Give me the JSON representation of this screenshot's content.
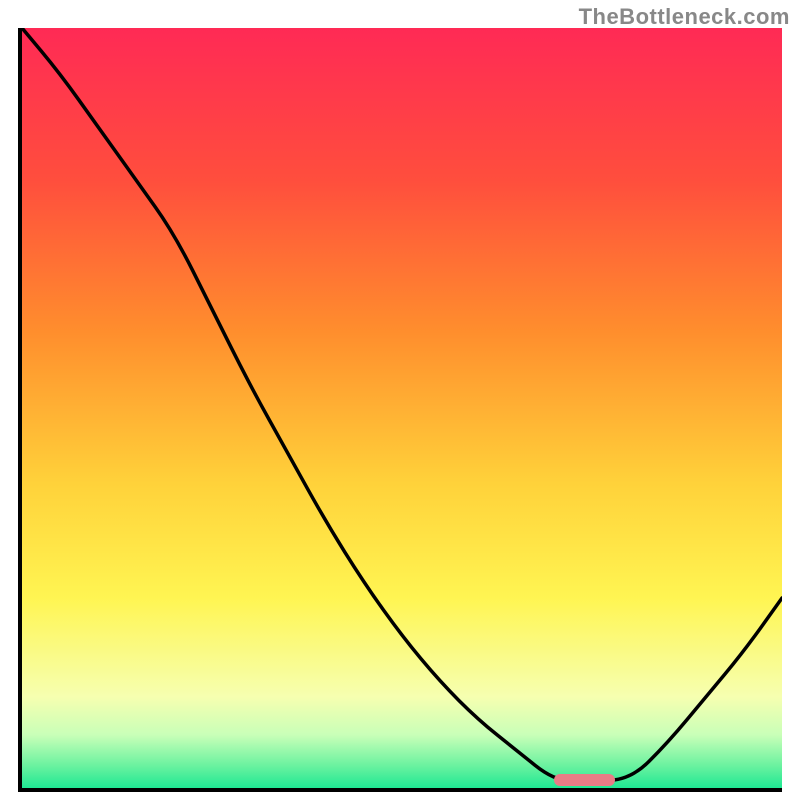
{
  "attribution": "TheBottleneck.com",
  "chart_data": {
    "type": "line",
    "title": "",
    "xlabel": "",
    "ylabel": "",
    "x": [
      0.0,
      0.05,
      0.1,
      0.15,
      0.2,
      0.25,
      0.3,
      0.35,
      0.4,
      0.45,
      0.5,
      0.55,
      0.6,
      0.65,
      0.7,
      0.74,
      0.8,
      0.85,
      0.9,
      0.95,
      1.0
    ],
    "values": [
      1.0,
      0.94,
      0.87,
      0.8,
      0.73,
      0.63,
      0.53,
      0.44,
      0.35,
      0.27,
      0.2,
      0.14,
      0.09,
      0.05,
      0.01,
      0.01,
      0.01,
      0.06,
      0.12,
      0.18,
      0.25
    ],
    "xlim": [
      0,
      1
    ],
    "ylim": [
      0,
      1
    ],
    "flat_region_x": [
      0.7,
      0.78
    ],
    "background": {
      "type": "vertical_gradient",
      "stops": [
        {
          "t": 0.0,
          "color": "#ff2a55"
        },
        {
          "t": 0.2,
          "color": "#ff4e3d"
        },
        {
          "t": 0.4,
          "color": "#ff8e2d"
        },
        {
          "t": 0.6,
          "color": "#ffd23a"
        },
        {
          "t": 0.75,
          "color": "#fff552"
        },
        {
          "t": 0.88,
          "color": "#f6ffb0"
        },
        {
          "t": 0.93,
          "color": "#c9ffb8"
        },
        {
          "t": 0.97,
          "color": "#6cf2a0"
        },
        {
          "t": 1.0,
          "color": "#1fe893"
        }
      ]
    }
  }
}
